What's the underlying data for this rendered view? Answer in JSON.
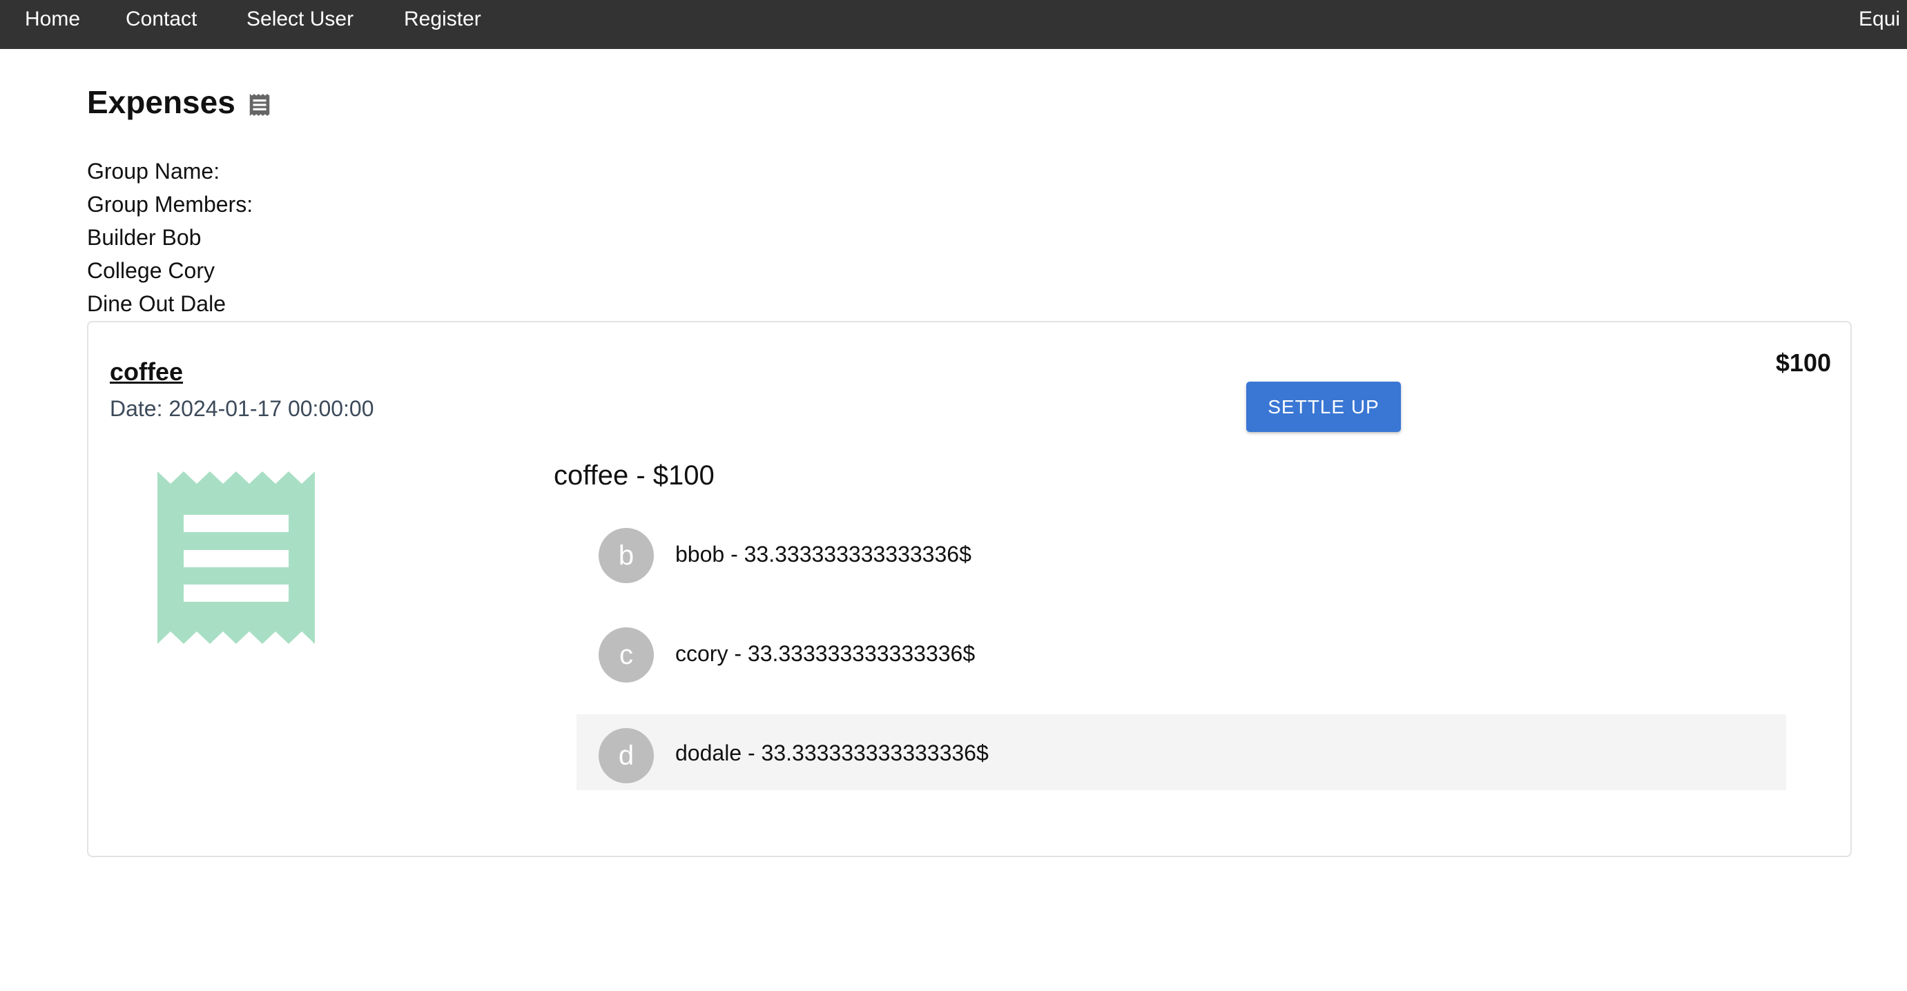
{
  "nav": {
    "home": "Home",
    "contact": "Contact",
    "select_user": "Select User",
    "register": "Register",
    "right_partial": "Equi"
  },
  "page": {
    "title": "Expenses",
    "title_icon": "receipt-icon"
  },
  "group": {
    "name_label": "Group Name:",
    "members_label": "Group Members:",
    "members": [
      "Builder Bob",
      "College Cory",
      "Dine Out Dale"
    ]
  },
  "expense": {
    "title": "coffee",
    "date": "Date: 2024-01-17 00:00:00",
    "amount": "$100",
    "settle_label": "SETTLE UP",
    "image_icon": "receipt-icon",
    "split_header": "coffee - $100",
    "splits": [
      {
        "initial": "b",
        "text": "bbob - 33.333333333333336$"
      },
      {
        "initial": "c",
        "text": "ccory - 33.333333333333336$"
      },
      {
        "initial": "d",
        "text": "dodale - 33.333333333333336$"
      }
    ]
  },
  "colors": {
    "navbar": "#333333",
    "accent_button": "#3a77d4",
    "receipt_art": "#a8dfc4",
    "avatar": "#bdbdbd",
    "hover_row": "#f4f4f4"
  }
}
